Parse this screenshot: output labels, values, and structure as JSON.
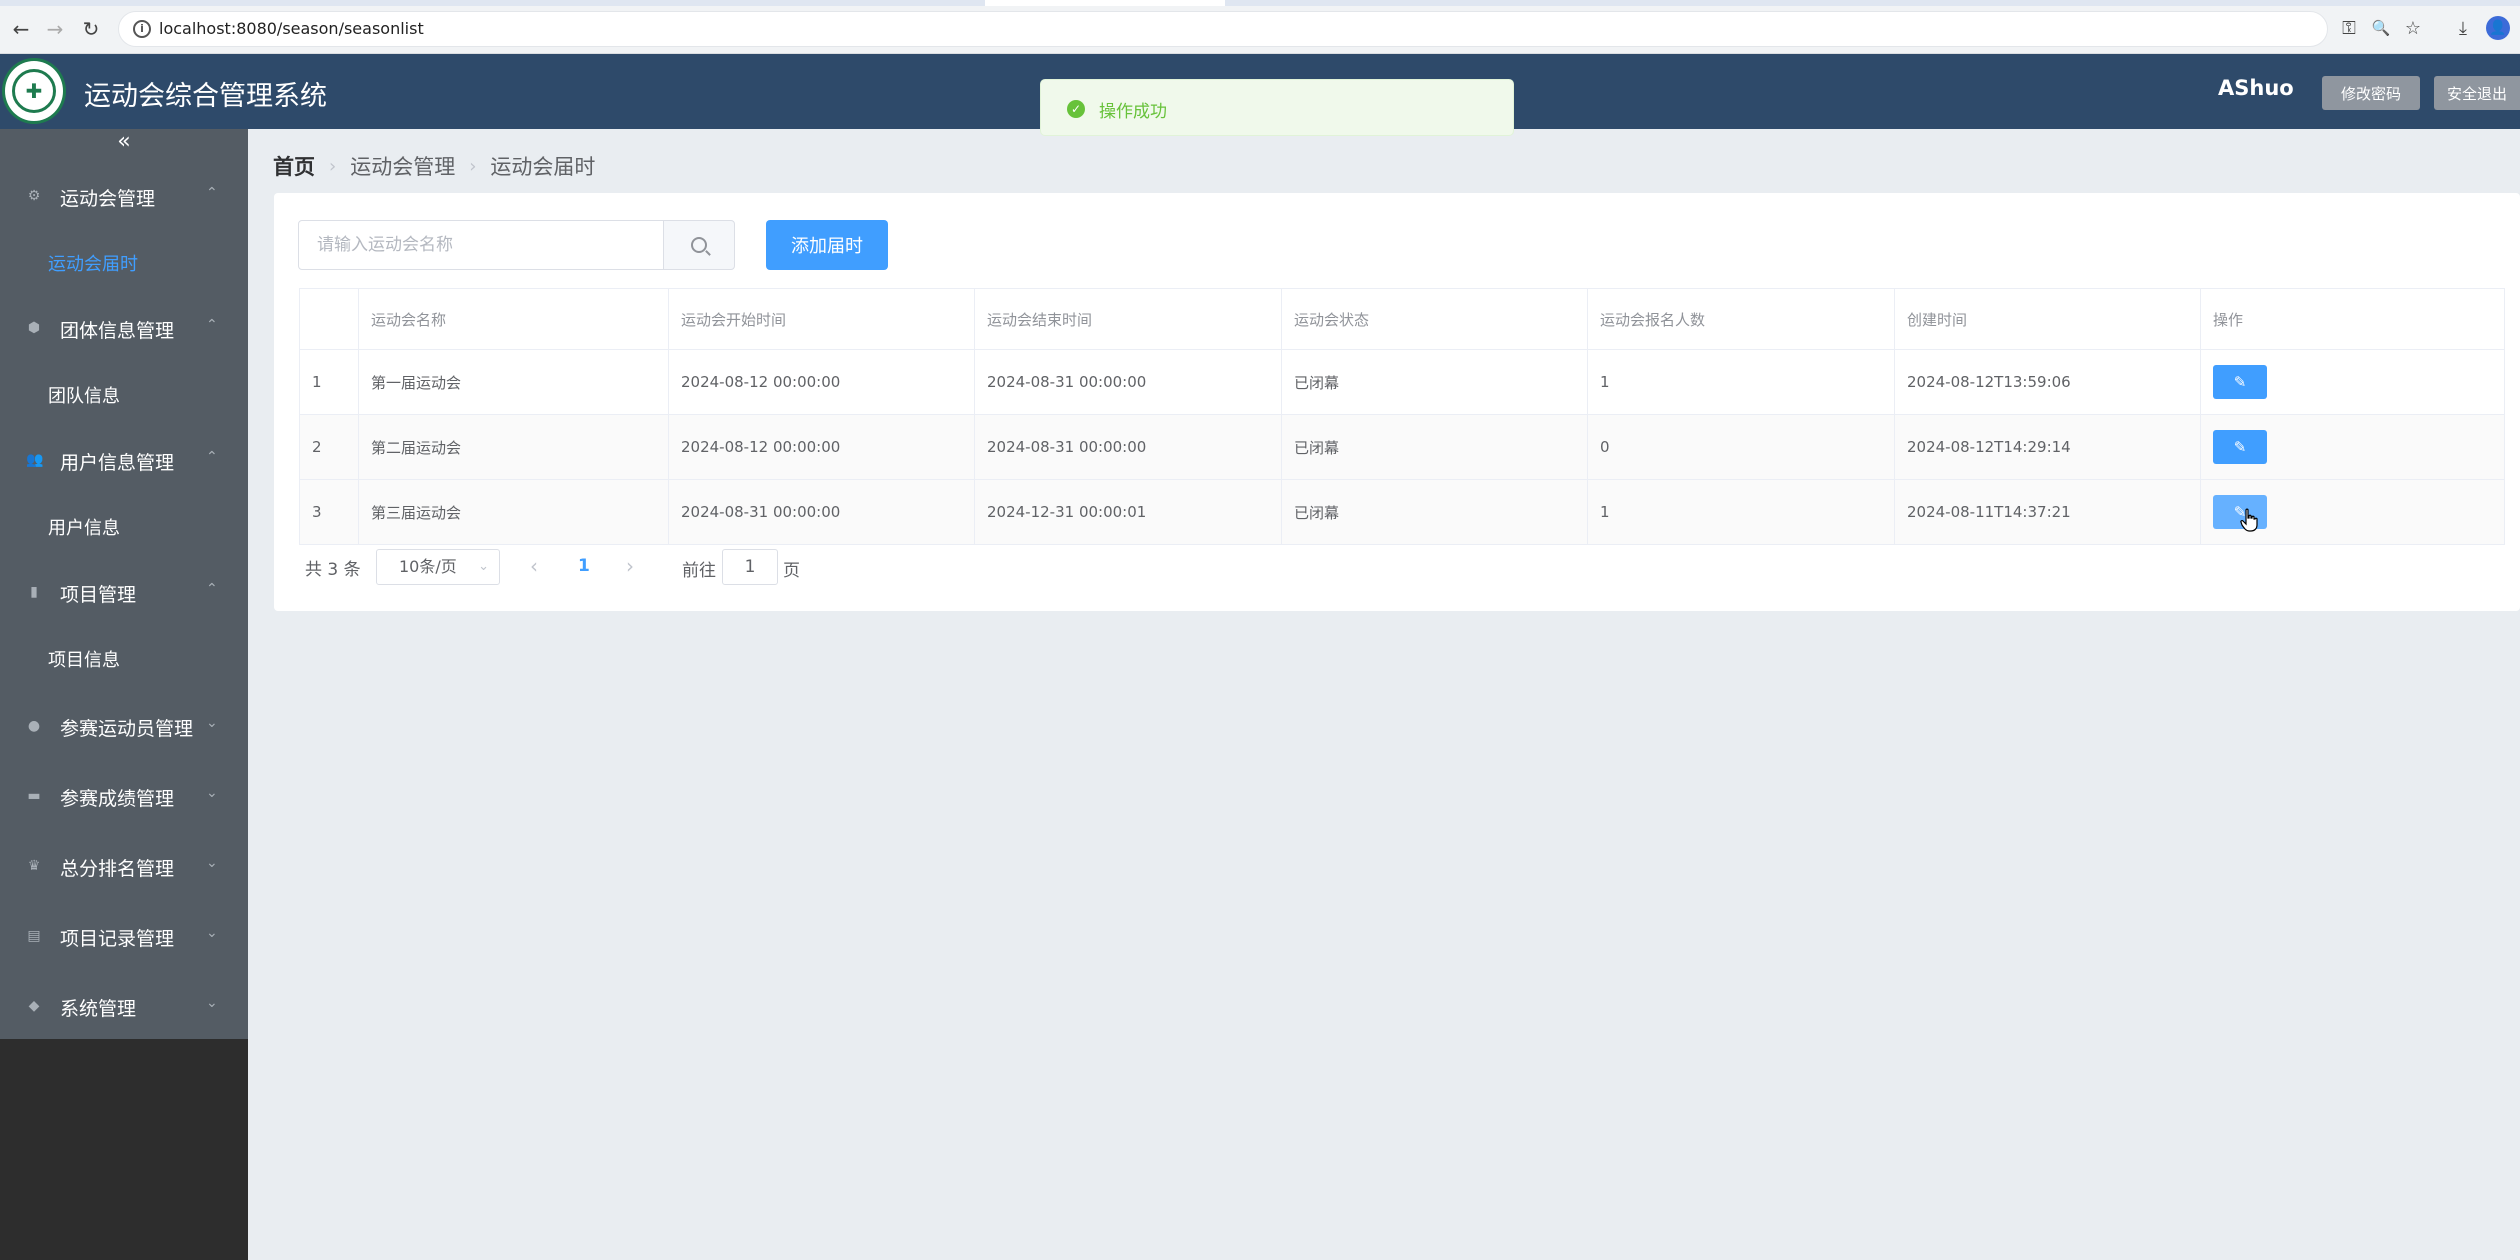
{
  "browser": {
    "url": "localhost:8080/season/seasonlist",
    "back_icon": "←",
    "forward_icon": "→",
    "reload_icon": "↻",
    "key_icon": "⚿",
    "zoom_icon": "🔍",
    "star_icon": "☆",
    "download_icon": "⤓",
    "profile_icon": "👤"
  },
  "header": {
    "title": "运动会综合管理系统",
    "user": "AShuo",
    "change_password": "修改密码",
    "logout": "安全退出"
  },
  "toast": {
    "message": "操作成功",
    "icon": "✓"
  },
  "sidebar": {
    "collapse_icon": "«",
    "groups": [
      {
        "label": "运动会管理",
        "expanded": true,
        "sub": "运动会届时",
        "sub_active": true
      },
      {
        "label": "团体信息管理",
        "expanded": true,
        "sub": "团队信息"
      },
      {
        "label": "用户信息管理",
        "expanded": true,
        "sub": "用户信息"
      },
      {
        "label": "项目管理",
        "expanded": true,
        "sub": "项目信息"
      },
      {
        "label": "参赛运动员管理",
        "expanded": false
      },
      {
        "label": "参赛成绩管理",
        "expanded": false
      },
      {
        "label": "总分排名管理",
        "expanded": false
      },
      {
        "label": "项目记录管理",
        "expanded": false
      },
      {
        "label": "系统管理",
        "expanded": false
      }
    ]
  },
  "breadcrumb": [
    "首页",
    "运动会管理",
    "运动会届时"
  ],
  "search": {
    "placeholder": "请输入运动会名称",
    "add_label": "添加届时"
  },
  "table": {
    "headers": [
      "",
      "运动会名称",
      "运动会开始时间",
      "运动会结束时间",
      "运动会状态",
      "运动会报名人数",
      "创建时间",
      "操作"
    ],
    "rows": [
      [
        "1",
        "第一届运动会",
        "2024-08-12 00:00:00",
        "2024-08-31 00:00:00",
        "已闭幕",
        "1",
        "2024-08-12T13:59:06"
      ],
      [
        "2",
        "第二届运动会",
        "2024-08-12 00:00:00",
        "2024-08-31 00:00:00",
        "已闭幕",
        "0",
        "2024-08-12T14:29:14"
      ],
      [
        "3",
        "第三届运动会",
        "2024-08-31 00:00:00",
        "2024-12-31 00:00:01",
        "已闭幕",
        "1",
        "2024-08-11T14:37:21"
      ]
    ],
    "edit_icon": "✎"
  },
  "pagination": {
    "total": "共 3 条",
    "page_size": "10条/页",
    "current": "1",
    "goto_label": "前往",
    "goto_value": "1",
    "page_suffix": "页"
  },
  "colors": {
    "header_bg": "#2e4a6a",
    "sidebar_bg": "#545c64",
    "primary": "#409eff",
    "success": "#67c23a"
  }
}
